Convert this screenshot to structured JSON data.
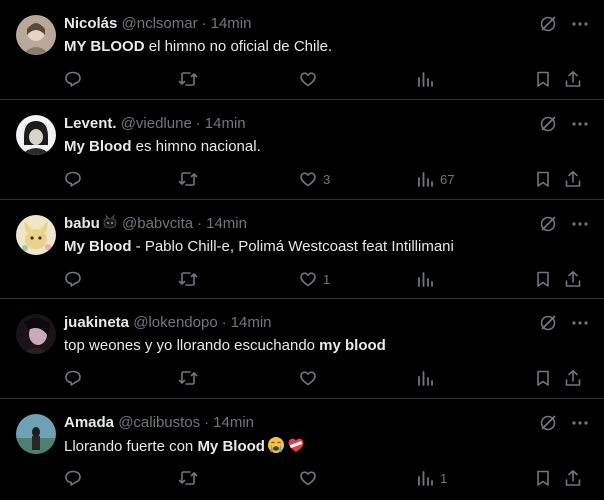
{
  "colors": {
    "background": "#000000",
    "text": "#e7e9ea",
    "muted": "#71767b",
    "divider": "#2f3336"
  },
  "tweets": [
    {
      "name": "Nicolás",
      "handle": "@nclsomar",
      "time": "14min",
      "text_parts": [
        {
          "bold": true,
          "t": "MY BLOOD"
        },
        {
          "bold": false,
          "t": " el himno no oficial de Chile."
        }
      ],
      "likes": "",
      "views": ""
    },
    {
      "name": "Levent.",
      "handle": "@viedlune",
      "time": "14min",
      "text_parts": [
        {
          "bold": true,
          "t": "My Blood"
        },
        {
          "bold": false,
          "t": " es himno nacional."
        }
      ],
      "likes": "3",
      "views": "67"
    },
    {
      "name": "babu",
      "name_icon": "black-cat-emoji",
      "handle": "@babvcita",
      "time": "14min",
      "text_parts": [
        {
          "bold": true,
          "t": "My Blood"
        },
        {
          "bold": false,
          "t": " - Pablo Chill-e, Polimá Westcoast feat Intillimani"
        }
      ],
      "likes": "1",
      "views": ""
    },
    {
      "name": "juakineta",
      "handle": "@lokendopo",
      "time": "14min",
      "text_parts": [
        {
          "bold": false,
          "t": "top weones y yo llorando escuchando "
        },
        {
          "bold": true,
          "t": "my blood"
        }
      ],
      "likes": "",
      "views": ""
    },
    {
      "name": "Amada",
      "handle": "@calibustos",
      "time": "14min",
      "text_parts": [
        {
          "bold": false,
          "t": "Llorando fuerte con "
        },
        {
          "bold": true,
          "t": "My Blood"
        }
      ],
      "emojis": [
        "crying-face-emoji",
        "bandaged-heart-emoji"
      ],
      "likes": "",
      "views": "1"
    }
  ]
}
